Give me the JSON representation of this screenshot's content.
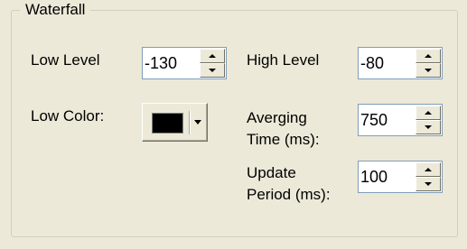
{
  "group": {
    "title": "Waterfall"
  },
  "fields": {
    "low_level": {
      "label": "Low Level",
      "value": "-130"
    },
    "high_level": {
      "label": "High Level",
      "value": "-80"
    },
    "low_color": {
      "label": "Low Color:",
      "color": "#000000"
    },
    "averaging_time": {
      "label_line1": "Averging",
      "label_line2": "Time (ms):",
      "value": "750"
    },
    "update_period": {
      "label_line1": "Update",
      "label_line2": "Period (ms):",
      "value": "100"
    }
  },
  "icons": {
    "spin_up": "up-arrow-icon",
    "spin_down": "down-arrow-icon",
    "dropdown": "dropdown-arrow-icon"
  }
}
